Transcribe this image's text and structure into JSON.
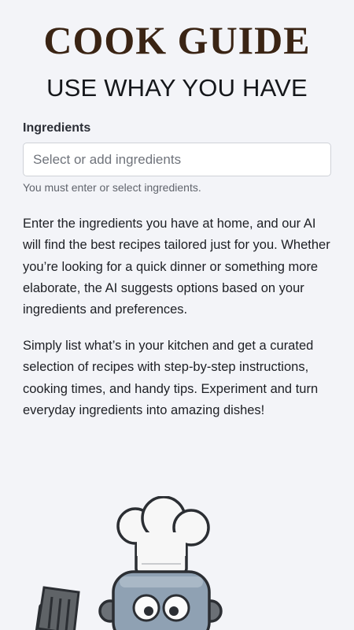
{
  "app": {
    "logo_text": "COOK GUIDE",
    "subtitle": "USE WHAY YOU HAVE"
  },
  "ingredients_field": {
    "label": "Ingredients",
    "placeholder": "Select or add ingredients",
    "value": "",
    "helper_text": "You must enter or select ingredients."
  },
  "description": {
    "paragraphs": [
      "Enter the ingredients you have at home, and our AI will find the best recipes tailored just for you. Whether you’re looking for a quick dinner or something more elaborate, the AI suggests options based on your ingredients and preferences.",
      "Simply list what’s in your kitchen and get a curated selection of recipes with step-by-step instructions, cooking times, and handy tips. Experiment and turn everyday ingredients into amazing dishes!"
    ]
  },
  "mascot": {
    "icon": "robot-chef-icon"
  },
  "colors": {
    "background": "#f3f4f8",
    "logo": "#3a2414",
    "text": "#1d1f24",
    "muted_text": "#60646c",
    "input_border": "#cfd2d8"
  }
}
